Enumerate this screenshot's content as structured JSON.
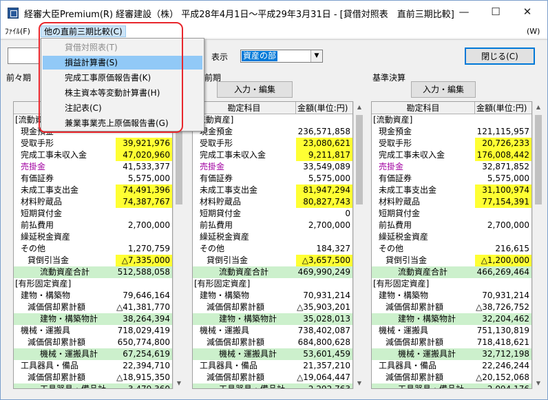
{
  "window": {
    "title": "経審大臣Premium(R)  経審建設（株）  平成28年4月1日～平成29年3月31日 - [貸借対照表　直前三期比較]",
    "minimize": "—",
    "maximize": "☐",
    "close": "✕"
  },
  "menubar": {
    "file": "ﾌｧｲﾙ(F)",
    "other": "他の直前三期比較(C)",
    "w": "(W)"
  },
  "dropdown": {
    "items": [
      {
        "label": "貸借対照表(T)"
      },
      {
        "label": "損益計算書(S)"
      },
      {
        "label": "完成工事原価報告書(K)"
      },
      {
        "label": "株主資本等変動計算書(H)"
      },
      {
        "label": "注記表(C)"
      },
      {
        "label": "兼業事業売上原価報告書(G)"
      }
    ]
  },
  "toolbar": {
    "display_label": "表示",
    "select_value": "資産の部",
    "close_button": "閉じる(C)"
  },
  "panels": [
    {
      "title": "前々期",
      "button": "入力・編集",
      "col_name": "勘定科目",
      "col_value": "金額(単位:円)",
      "rows": [
        {
          "n": "[流動資産]",
          "v": ""
        },
        {
          "n": "現金預金",
          "v": ""
        },
        {
          "n": "受取手形",
          "v": "39,921,976"
        },
        {
          "n": "完成工事未収入金",
          "v": "47,020,960"
        },
        {
          "n": "売掛金",
          "v": "41,533,377"
        },
        {
          "n": "有価証券",
          "v": "5,575,000"
        },
        {
          "n": "未成工事支出金",
          "v": "74,491,396"
        },
        {
          "n": "材料貯蔵品",
          "v": "74,387,767"
        },
        {
          "n": "短期貸付金",
          "v": ""
        },
        {
          "n": "前払費用",
          "v": "2,700,000"
        },
        {
          "n": "繰延税金資産",
          "v": ""
        },
        {
          "n": "その他",
          "v": "1,270,759"
        },
        {
          "n": "貸倒引当金",
          "v": "△7,335,000"
        },
        {
          "n": "流動資産合計",
          "v": "512,588,058"
        },
        {
          "n": "[有形固定資産]",
          "v": ""
        },
        {
          "n": "建物・構築物",
          "v": "79,646,164"
        },
        {
          "n": "減価償却累計額",
          "v": "△41,381,770"
        },
        {
          "n": "建物・構築物計",
          "v": "38,264,394"
        },
        {
          "n": "機械・運搬具",
          "v": "718,029,419"
        },
        {
          "n": "減価償却累計額",
          "v": "650,774,800"
        },
        {
          "n": "機械・運搬具計",
          "v": "67,254,619"
        },
        {
          "n": "工具器具・備品",
          "v": "22,394,710"
        },
        {
          "n": "減価償却累計額",
          "v": "△18,915,350"
        },
        {
          "n": "工具器具・備品計",
          "v": "3,479,360"
        }
      ]
    },
    {
      "title": "前期",
      "button": "入力・編集",
      "col_name": "勘定科目",
      "col_value": "金額(単位:円)",
      "rows": [
        {
          "n": "[流動資産]",
          "v": ""
        },
        {
          "n": "現金預金",
          "v": "236,571,858"
        },
        {
          "n": "受取手形",
          "v": "23,080,621"
        },
        {
          "n": "完成工事未収入金",
          "v": "9,211,817"
        },
        {
          "n": "売掛金",
          "v": "33,549,089"
        },
        {
          "n": "有価証券",
          "v": "5,575,000"
        },
        {
          "n": "未成工事支出金",
          "v": "81,947,294"
        },
        {
          "n": "材料貯蔵品",
          "v": "80,827,743"
        },
        {
          "n": "短期貸付金",
          "v": "0"
        },
        {
          "n": "前払費用",
          "v": "2,700,000"
        },
        {
          "n": "繰延税金資産",
          "v": ""
        },
        {
          "n": "その他",
          "v": "184,327"
        },
        {
          "n": "貸倒引当金",
          "v": "△3,657,500"
        },
        {
          "n": "流動資産合計",
          "v": "469,990,249"
        },
        {
          "n": "[有形固定資産]",
          "v": ""
        },
        {
          "n": "建物・構築物",
          "v": "70,931,214"
        },
        {
          "n": "減価償却累計額",
          "v": "△35,903,201"
        },
        {
          "n": "建物・構築物計",
          "v": "35,028,013"
        },
        {
          "n": "機械・運搬具",
          "v": "738,402,087"
        },
        {
          "n": "減価償却累計額",
          "v": "684,800,628"
        },
        {
          "n": "機械・運搬具計",
          "v": "53,601,459"
        },
        {
          "n": "工具器具・備品",
          "v": "21,357,210"
        },
        {
          "n": "減価償却累計額",
          "v": "△19,064,447"
        },
        {
          "n": "工具器具・備品計",
          "v": "2,292,763"
        }
      ]
    },
    {
      "title": "基準決算",
      "button": "入力・編集",
      "col_name": "勘定科目",
      "col_value": "金額(単位:円)",
      "rows": [
        {
          "n": "[流動資産]",
          "v": ""
        },
        {
          "n": "現金預金",
          "v": "121,115,957"
        },
        {
          "n": "受取手形",
          "v": "20,726,233"
        },
        {
          "n": "完成工事未収入金",
          "v": "176,008,442"
        },
        {
          "n": "売掛金",
          "v": "32,871,852"
        },
        {
          "n": "有価証券",
          "v": "5,575,000"
        },
        {
          "n": "未成工事支出金",
          "v": "31,100,974"
        },
        {
          "n": "材料貯蔵品",
          "v": "77,154,391"
        },
        {
          "n": "短期貸付金",
          "v": ""
        },
        {
          "n": "前払費用",
          "v": "2,700,000"
        },
        {
          "n": "繰延税金資産",
          "v": ""
        },
        {
          "n": "その他",
          "v": "216,615"
        },
        {
          "n": "貸倒引当金",
          "v": "△1,200,000"
        },
        {
          "n": "流動資産合計",
          "v": "466,269,464"
        },
        {
          "n": "[有形固定資産]",
          "v": ""
        },
        {
          "n": "建物・構築物",
          "v": "70,931,214"
        },
        {
          "n": "減価償却累計額",
          "v": "△38,726,752"
        },
        {
          "n": "建物・構築物計",
          "v": "32,204,462"
        },
        {
          "n": "機械・運搬具",
          "v": "751,130,819"
        },
        {
          "n": "減価償却累計額",
          "v": "718,418,621"
        },
        {
          "n": "機械・運搬具計",
          "v": "32,712,198"
        },
        {
          "n": "工具器具・備品",
          "v": "22,246,244"
        },
        {
          "n": "減価償却累計額",
          "v": "△20,152,068"
        },
        {
          "n": "工具器具・備品計",
          "v": "2,094,176"
        }
      ]
    }
  ],
  "colors": {
    "highlight": "#ffff33",
    "total_row": "#ccf0cc",
    "selection": "#0078d7",
    "callout": "#e8262c"
  }
}
